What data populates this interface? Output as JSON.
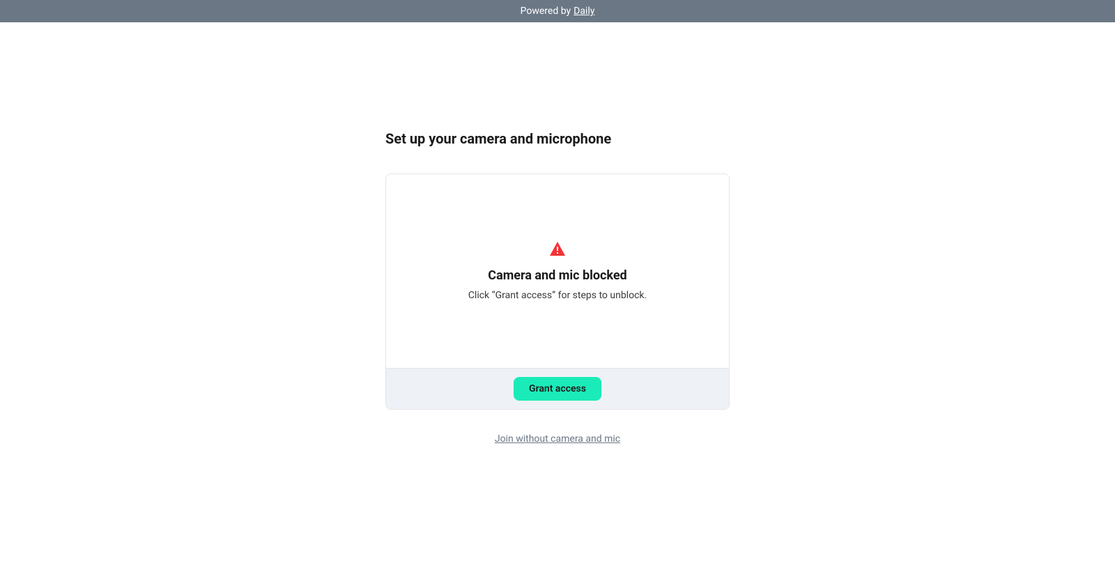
{
  "header": {
    "prefix": "Powered by ",
    "link_text": "Daily"
  },
  "page": {
    "title": "Set up your camera and microphone"
  },
  "card": {
    "blocked_title": "Camera and mic blocked",
    "blocked_subtitle": "Click “Grant access” for steps to unblock.",
    "grant_button_label": "Grant access"
  },
  "join_link": {
    "label": "Join without camera and mic"
  }
}
